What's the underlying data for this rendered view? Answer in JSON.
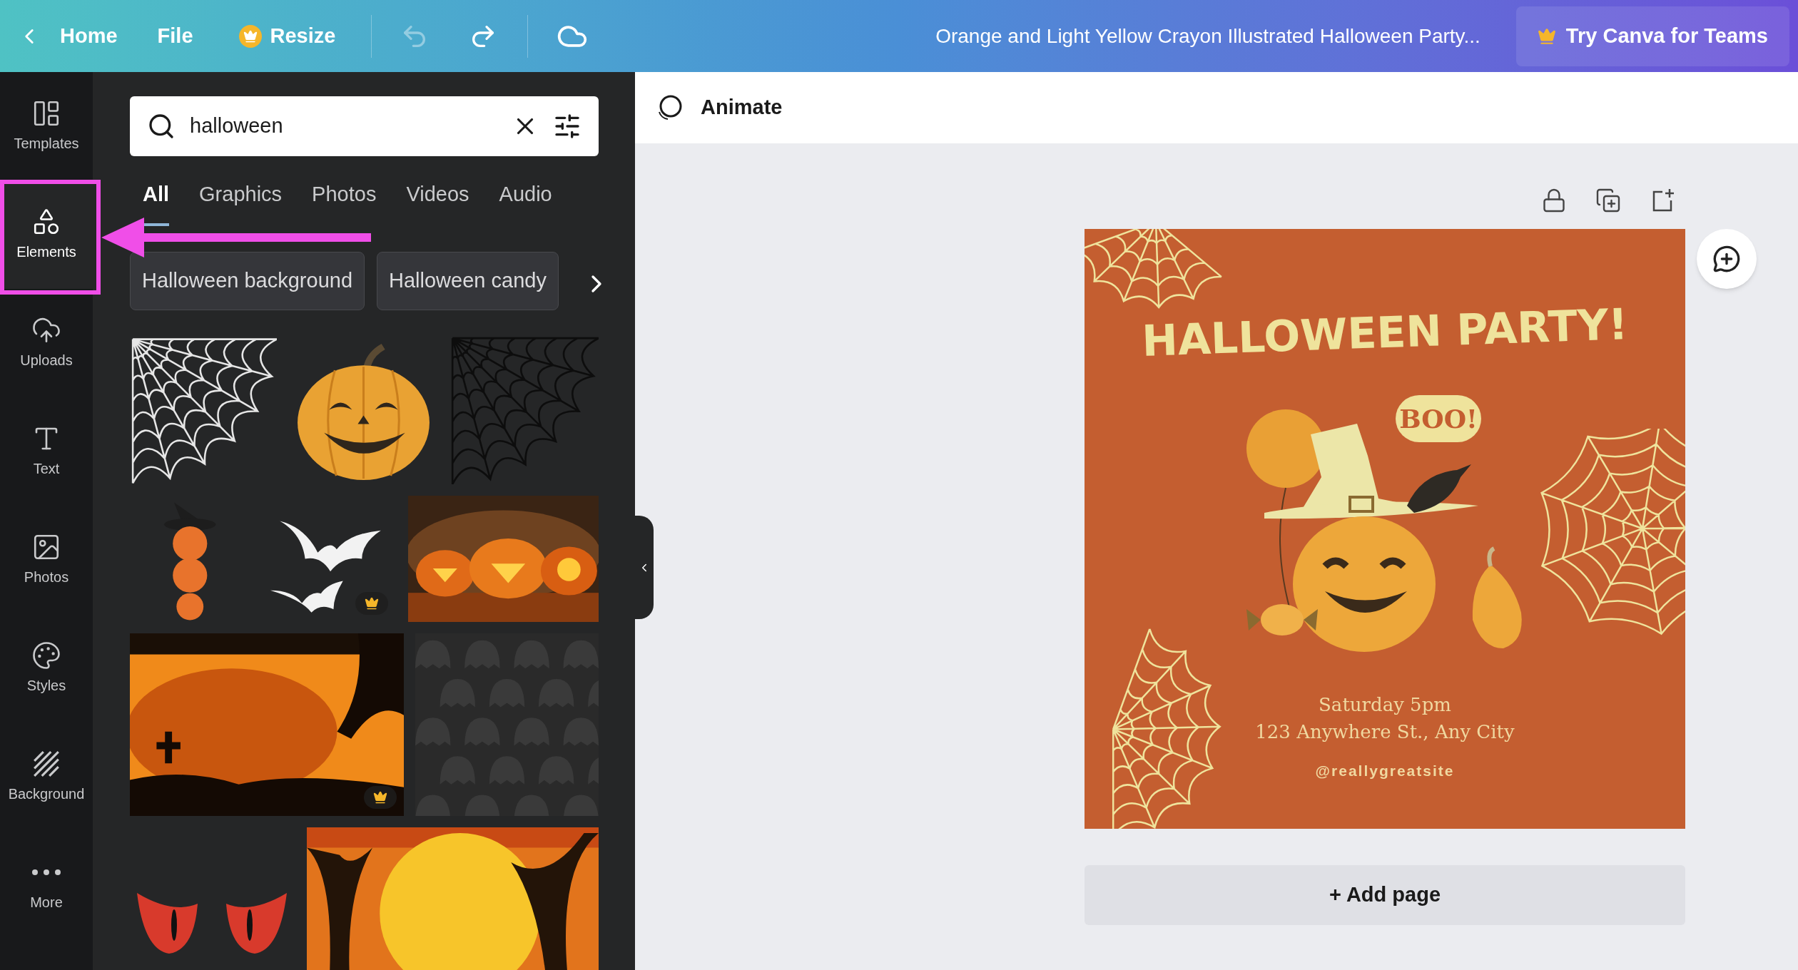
{
  "top_bar": {
    "home": "Home",
    "file": "File",
    "resize": "Resize",
    "undo": {
      "disabled": true
    },
    "redo": {
      "disabled": false
    },
    "document_title": "Orange and Light Yellow Crayon Illustrated Halloween Party...",
    "teams_button": "Try Canva for Teams"
  },
  "sidebar": {
    "items": [
      {
        "label": "Templates",
        "selected": false
      },
      {
        "label": "Elements",
        "selected": true
      },
      {
        "label": "Uploads",
        "selected": false
      },
      {
        "label": "Text",
        "selected": false
      },
      {
        "label": "Photos",
        "selected": false
      },
      {
        "label": "Styles",
        "selected": false
      },
      {
        "label": "Background",
        "selected": false
      },
      {
        "label": "More",
        "selected": false
      }
    ]
  },
  "panel": {
    "search": {
      "value": "halloween"
    },
    "tabs": [
      {
        "label": "All",
        "selected": true
      },
      {
        "label": "Graphics",
        "selected": false
      },
      {
        "label": "Photos",
        "selected": false
      },
      {
        "label": "Videos",
        "selected": false
      },
      {
        "label": "Audio",
        "selected": false
      }
    ],
    "chips": [
      "Halloween background",
      "Halloween candy"
    ],
    "results": [
      {
        "items": [
          {
            "kind": "web",
            "color": "#e6e6e6",
            "premium": false
          },
          {
            "kind": "pumpkin",
            "premium": false
          },
          {
            "kind": "web",
            "color": "#0d0d0d",
            "premium": false
          }
        ]
      },
      {
        "items": [
          {
            "kind": "stack",
            "premium": false
          },
          {
            "kind": "bats",
            "premium": true
          },
          {
            "kind": "picture",
            "premium": false
          }
        ]
      },
      {
        "items": [
          {
            "kind": "picture",
            "premium": true
          },
          {
            "kind": "pattern",
            "premium": false
          }
        ]
      },
      {
        "items": [
          {
            "kind": "eyes",
            "premium": false
          },
          {
            "kind": "picture",
            "premium": false
          }
        ]
      }
    ]
  },
  "canvas": {
    "animate": "Animate",
    "design": {
      "title": "HALLOWEEN PARTY!",
      "speech": "BOO!",
      "lines": [
        "Saturday 5pm",
        "123 Anywhere St., Any City"
      ],
      "handle": "@reallygreatsite"
    },
    "add_page": "+ Add page"
  }
}
